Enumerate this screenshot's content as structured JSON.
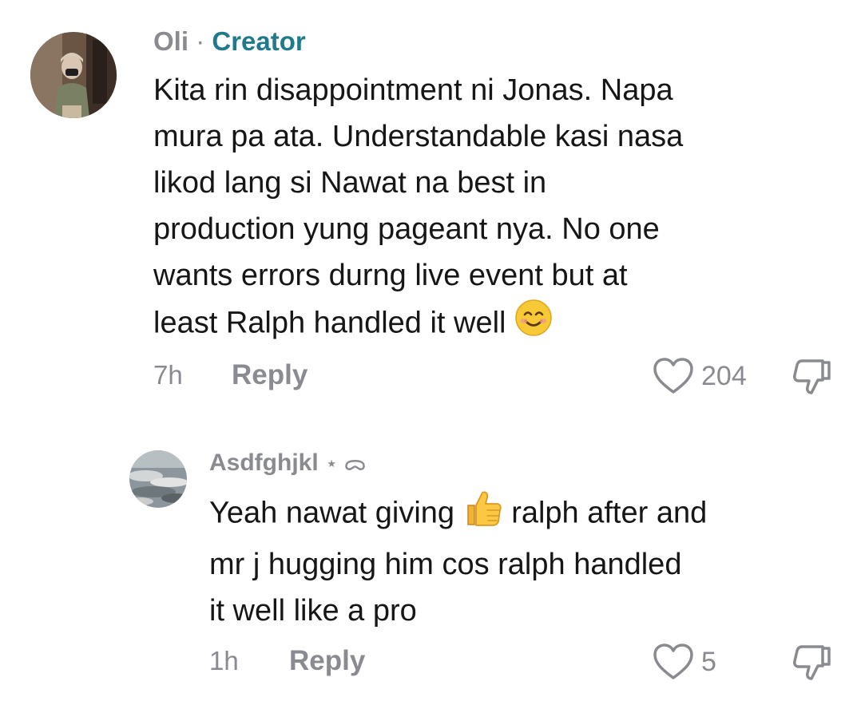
{
  "comments": [
    {
      "author": "Oli",
      "separator": "·",
      "badge": "Creator",
      "lines": [
        "Kita rin disappointment ni Jonas. Napa",
        "mura pa ata. Understandable kasi nasa",
        "likod lang si Nawat na best in",
        "production yung pageant nya. No one",
        "wants errors durng live event but at",
        "least Ralph handled it well"
      ],
      "trailing_emoji": "smiling-face-emoji",
      "time": "7h",
      "reply_label": "Reply",
      "likes": "204",
      "like_icon": "heart-outline-icon",
      "dislike_icon": "thumbs-down-icon"
    },
    {
      "author": "Asdfghjkl",
      "author_suffix": "⋆ ᯅ",
      "line1_before": "Yeah nawat giving",
      "line1_emoji": "thumbs-up-emoji",
      "line1_after": "ralph after and",
      "lines_rest": [
        "mr j hugging him cos ralph handled",
        "it well like a pro"
      ],
      "time": "1h",
      "reply_label": "Reply",
      "likes": "5",
      "like_icon": "heart-outline-icon",
      "dislike_icon": "thumbs-down-icon"
    }
  ],
  "colors": {
    "text": "#161616",
    "muted": "#8a8b91",
    "creator_badge": "#1f7a8c",
    "background": "#ffffff"
  }
}
